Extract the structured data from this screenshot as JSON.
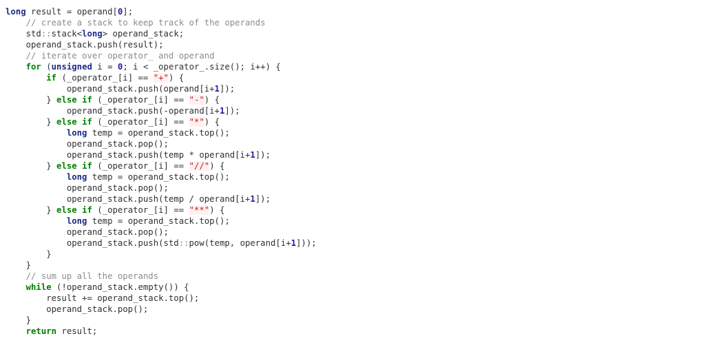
{
  "colors": {
    "background": "#ffffff",
    "text": "#303030",
    "keyword": "#008000",
    "type": "#1b2b85",
    "number": "#1a1aa6",
    "string": "#ba2121",
    "string_bg": "#fff0f0",
    "comment": "#8c8c8c"
  },
  "lines": [
    [
      [
        "type",
        "long"
      ],
      [
        "plain",
        " result = operand["
      ],
      [
        "num",
        "0"
      ],
      [
        "plain",
        "];"
      ]
    ],
    [
      [
        "plain",
        "    "
      ],
      [
        "cm",
        "// create a stack to keep track of the operands"
      ]
    ],
    [
      [
        "plain",
        "    std"
      ],
      [
        "ns",
        "::"
      ],
      [
        "plain",
        "stack<"
      ],
      [
        "type",
        "long"
      ],
      [
        "plain",
        "> operand_stack;"
      ]
    ],
    [
      [
        "plain",
        "    operand_stack.push(result);"
      ]
    ],
    [
      [
        "plain",
        "    "
      ],
      [
        "cm",
        "// iterate over operator_ and operand"
      ]
    ],
    [
      [
        "plain",
        "    "
      ],
      [
        "kw",
        "for"
      ],
      [
        "plain",
        " ("
      ],
      [
        "type",
        "unsigned"
      ],
      [
        "plain",
        " i = "
      ],
      [
        "num",
        "0"
      ],
      [
        "plain",
        "; i < _operator_.size(); i++) {"
      ]
    ],
    [
      [
        "plain",
        "        "
      ],
      [
        "kw",
        "if"
      ],
      [
        "plain",
        " (_operator_[i] == "
      ],
      [
        "str",
        "\"+\""
      ],
      [
        "plain",
        ") {"
      ]
    ],
    [
      [
        "plain",
        "            operand_stack.push(operand[i+"
      ],
      [
        "num",
        "1"
      ],
      [
        "plain",
        "]);"
      ]
    ],
    [
      [
        "plain",
        "        } "
      ],
      [
        "kw",
        "else"
      ],
      [
        "plain",
        " "
      ],
      [
        "kw",
        "if"
      ],
      [
        "plain",
        " (_operator_[i] == "
      ],
      [
        "str",
        "\"-\""
      ],
      [
        "plain",
        ") {"
      ]
    ],
    [
      [
        "plain",
        "            operand_stack.push(-operand[i+"
      ],
      [
        "num",
        "1"
      ],
      [
        "plain",
        "]);"
      ]
    ],
    [
      [
        "plain",
        "        } "
      ],
      [
        "kw",
        "else"
      ],
      [
        "plain",
        " "
      ],
      [
        "kw",
        "if"
      ],
      [
        "plain",
        " (_operator_[i] == "
      ],
      [
        "str",
        "\"*\""
      ],
      [
        "plain",
        ") {"
      ]
    ],
    [
      [
        "plain",
        "            "
      ],
      [
        "type",
        "long"
      ],
      [
        "plain",
        " temp = operand_stack.top();"
      ]
    ],
    [
      [
        "plain",
        "            operand_stack.pop();"
      ]
    ],
    [
      [
        "plain",
        "            operand_stack.push(temp * operand[i+"
      ],
      [
        "num",
        "1"
      ],
      [
        "plain",
        "]);"
      ]
    ],
    [
      [
        "plain",
        "        } "
      ],
      [
        "kw",
        "else"
      ],
      [
        "plain",
        " "
      ],
      [
        "kw",
        "if"
      ],
      [
        "plain",
        " (_operator_[i] == "
      ],
      [
        "str",
        "\"//\""
      ],
      [
        "plain",
        ") {"
      ]
    ],
    [
      [
        "plain",
        "            "
      ],
      [
        "type",
        "long"
      ],
      [
        "plain",
        " temp = operand_stack.top();"
      ]
    ],
    [
      [
        "plain",
        "            operand_stack.pop();"
      ]
    ],
    [
      [
        "plain",
        "            operand_stack.push(temp / operand[i+"
      ],
      [
        "num",
        "1"
      ],
      [
        "plain",
        "]);"
      ]
    ],
    [
      [
        "plain",
        "        } "
      ],
      [
        "kw",
        "else"
      ],
      [
        "plain",
        " "
      ],
      [
        "kw",
        "if"
      ],
      [
        "plain",
        " (_operator_[i] == "
      ],
      [
        "str",
        "\"**\""
      ],
      [
        "plain",
        ") {"
      ]
    ],
    [
      [
        "plain",
        "            "
      ],
      [
        "type",
        "long"
      ],
      [
        "plain",
        " temp = operand_stack.top();"
      ]
    ],
    [
      [
        "plain",
        "            operand_stack.pop();"
      ]
    ],
    [
      [
        "plain",
        "            operand_stack.push(std"
      ],
      [
        "ns",
        "::"
      ],
      [
        "plain",
        "pow(temp, operand[i+"
      ],
      [
        "num",
        "1"
      ],
      [
        "plain",
        "]));"
      ]
    ],
    [
      [
        "plain",
        "        }"
      ]
    ],
    [
      [
        "plain",
        "    }"
      ]
    ],
    [
      [
        "plain",
        "    "
      ],
      [
        "cm",
        "// sum up all the operands"
      ]
    ],
    [
      [
        "plain",
        "    "
      ],
      [
        "kw",
        "while"
      ],
      [
        "plain",
        " (!operand_stack.empty()) {"
      ]
    ],
    [
      [
        "plain",
        "        result += operand_stack.top();"
      ]
    ],
    [
      [
        "plain",
        "        operand_stack.pop();"
      ]
    ],
    [
      [
        "plain",
        "    }"
      ]
    ],
    [
      [
        "plain",
        "    "
      ],
      [
        "kw",
        "return"
      ],
      [
        "plain",
        " result;"
      ]
    ]
  ]
}
